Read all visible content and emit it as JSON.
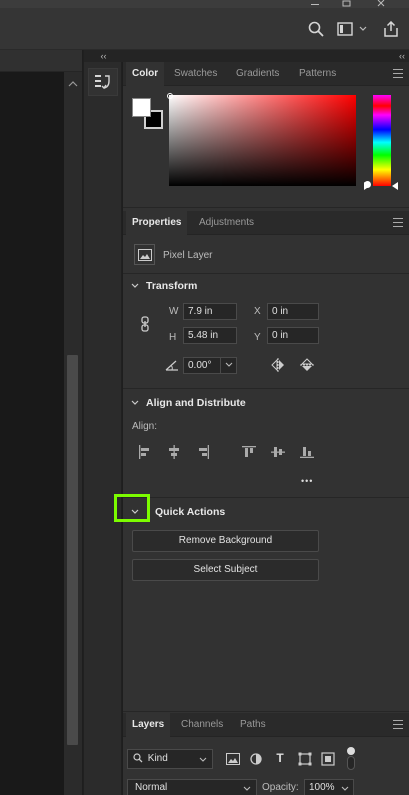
{
  "colors": {
    "accent": "#7cfc00",
    "panel_bg": "#323232"
  },
  "dock": {
    "collapse_glyph": "‹‹"
  },
  "color_panel": {
    "tabs": [
      "Color",
      "Swatches",
      "Gradients",
      "Patterns"
    ],
    "active_tab": "Color",
    "foreground_color": "#ffffff",
    "background_color": "#000000",
    "hue_position": 1.0
  },
  "properties_panel": {
    "tabs": [
      "Properties",
      "Adjustments"
    ],
    "active_tab": "Properties",
    "layer_kind": "Pixel Layer",
    "transform": {
      "title": "Transform",
      "w_label": "W",
      "w_value": "7.9 in",
      "h_label": "H",
      "h_value": "5.48 in",
      "x_label": "X",
      "x_value": "0 in",
      "y_label": "Y",
      "y_value": "0 in",
      "angle_value": "0.00°"
    },
    "align": {
      "title": "Align and Distribute",
      "align_label": "Align:",
      "more_label": "•••"
    },
    "quick_actions": {
      "title": "Quick Actions",
      "remove_background": "Remove Background",
      "select_subject": "Select Subject"
    }
  },
  "layers_panel": {
    "tabs": [
      "Layers",
      "Channels",
      "Paths"
    ],
    "active_tab": "Layers",
    "filter_kind": "Kind",
    "filter_type_glyph": "T",
    "blend_mode": "Normal",
    "opacity_label": "Opacity:",
    "opacity_value": "100%"
  }
}
